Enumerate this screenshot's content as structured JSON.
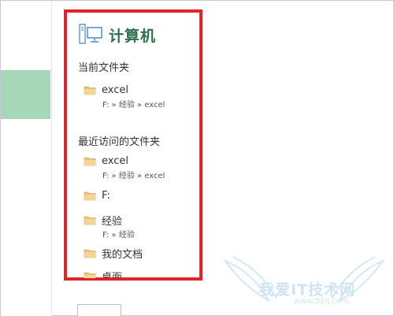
{
  "panel": {
    "title": "计算机",
    "title_icon": "computer-icon",
    "current_folder_header": "当前文件夹",
    "recent_header": "最近访问的文件夹"
  },
  "current_folder": [
    {
      "name": "excel",
      "path": "F: » 经验 » excel",
      "icon": "folder-icon"
    }
  ],
  "recent": [
    {
      "name": "excel",
      "path": "F: » 经验 » excel",
      "icon": "folder-icon"
    },
    {
      "name": "F:",
      "path": "",
      "icon": "folder-icon"
    },
    {
      "name": "经验",
      "path": "F: » 经验",
      "icon": "folder-icon"
    },
    {
      "name": "我的文档",
      "path": "",
      "icon": "folder-icon"
    },
    {
      "name": "桌面",
      "path": "",
      "icon": "folder-icon"
    }
  ],
  "watermark": {
    "text": "我爱IT技术网",
    "url": "www.52ij.com"
  },
  "colors": {
    "highlight": "#e0242a",
    "title": "#2f6f4e",
    "accent": "#a6d7b8",
    "folder": "#e8c27a"
  }
}
